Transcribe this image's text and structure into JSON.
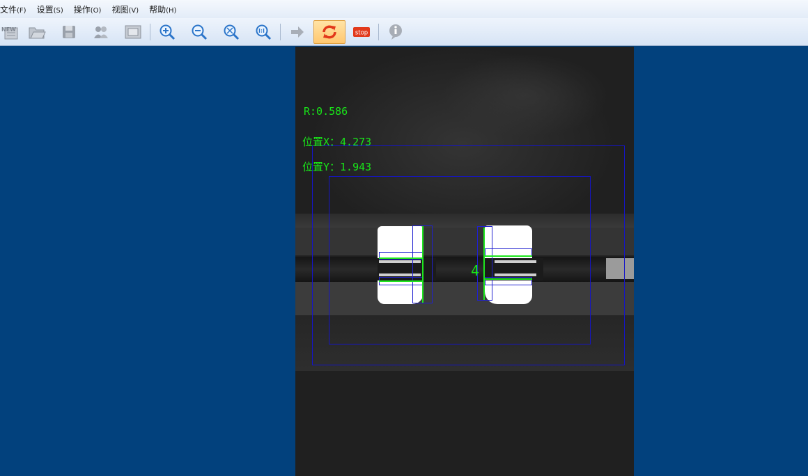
{
  "menu": [
    {
      "label": "文件",
      "key": "(F)"
    },
    {
      "label": "设置",
      "key": "(S)"
    },
    {
      "label": "操作",
      "key": "(O)"
    },
    {
      "label": "视图",
      "key": "(V)"
    },
    {
      "label": "帮助",
      "key": "(H)"
    }
  ],
  "toolbar": {
    "new_icon_text": "NEW",
    "stop_label": "stop",
    "active_tool": "cycle-run"
  },
  "overlay": {
    "r_text": "R:0.586",
    "pos_x_text": "位置X：4.273",
    "pos_y_text": "位置Y：1.943",
    "object_label": "4"
  },
  "colors": {
    "workspace_bg": "#02417d",
    "overlay_text": "#19e619",
    "roi_box": "#1414c8"
  }
}
